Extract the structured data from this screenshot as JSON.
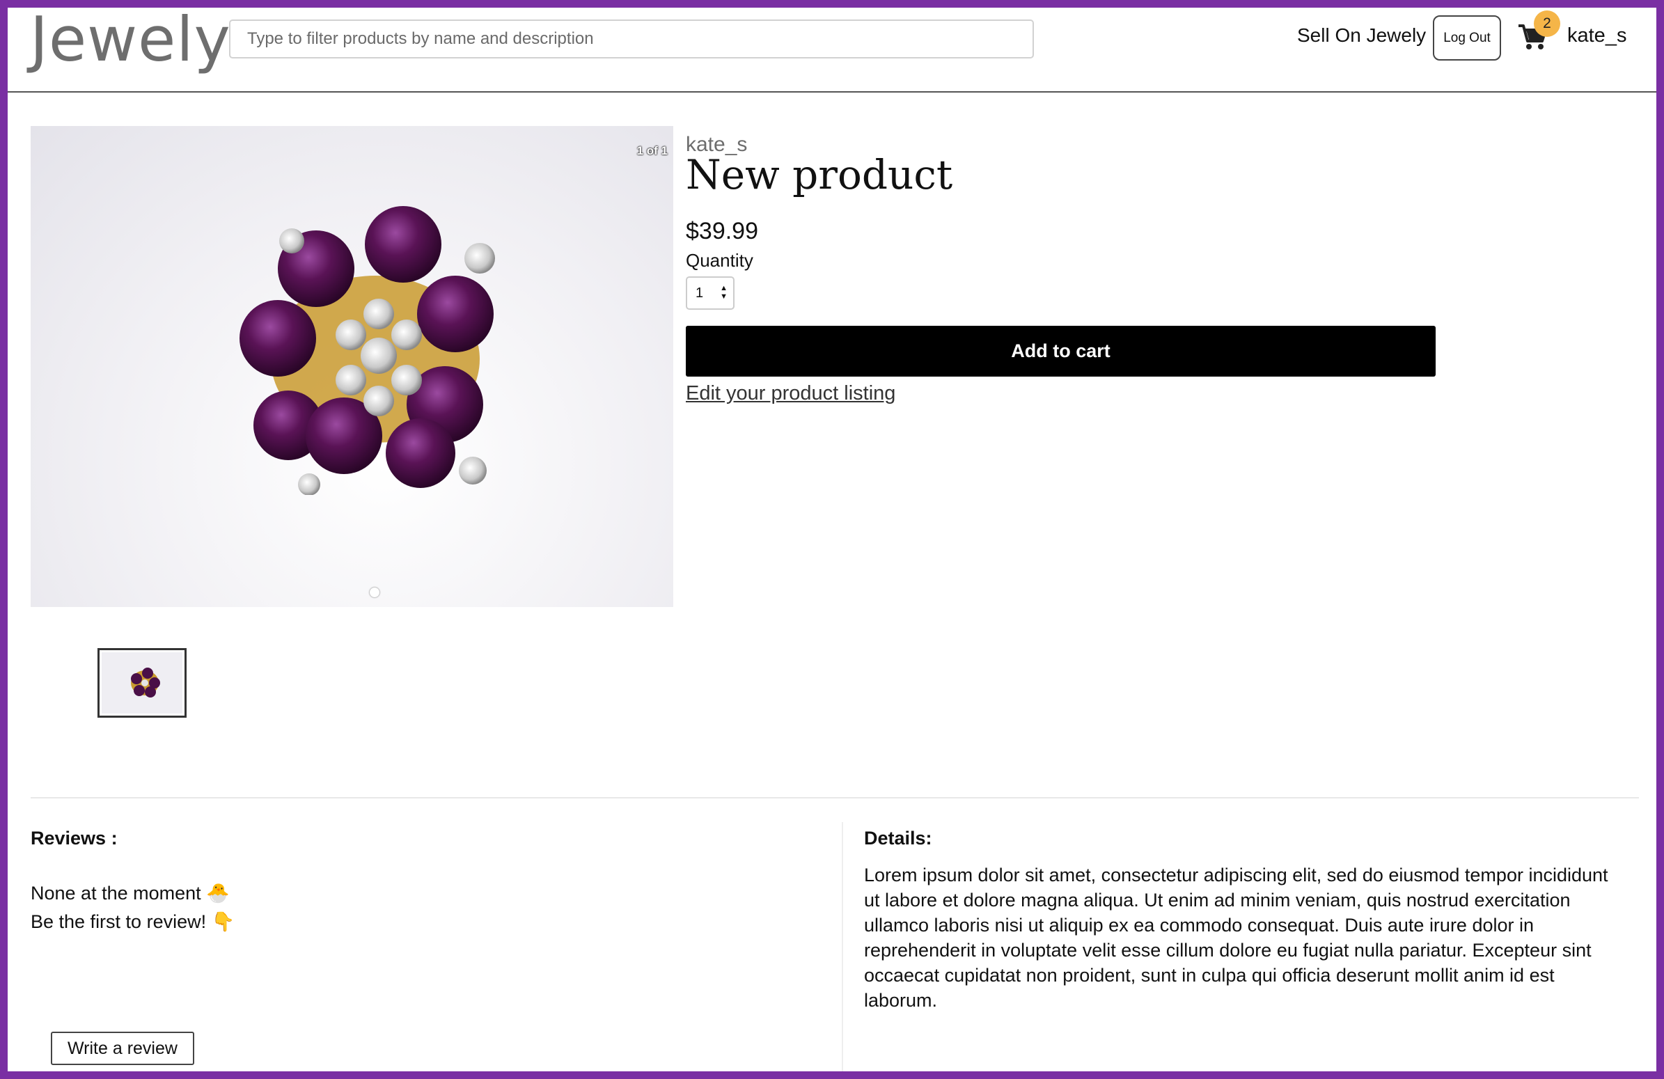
{
  "header": {
    "logo": "Jewely",
    "search_placeholder": "Type to filter products by name and description",
    "sell_label": "Sell On Jewely",
    "logout_label": "Log Out",
    "cart_count": "2",
    "username": "kate_s"
  },
  "product": {
    "image_counter": "1 of 1",
    "seller": "kate_s",
    "title": "New product",
    "price": "$39.99",
    "quantity_label": "Quantity",
    "quantity_value": "1",
    "add_to_cart_label": "Add to cart",
    "edit_link": "Edit your product listing"
  },
  "reviews": {
    "heading": "Reviews :",
    "empty_line_1": "None at the moment 🐣",
    "empty_line_2": "Be the first to review! 👇",
    "write_button": "Write a review"
  },
  "details": {
    "heading": "Details:",
    "body": "Lorem ipsum dolor sit amet, consectetur adipiscing elit, sed do eiusmod tempor incididunt ut labore et dolore magna aliqua. Ut enim ad minim veniam, quis nostrud exercitation ullamco laboris nisi ut aliquip ex ea commodo consequat. Duis aute irure dolor in reprehenderit in voluptate velit esse cillum dolore eu fugiat nulla pariatur. Excepteur sint occaecat cupidatat non proident, sunt in culpa qui officia deserunt mollit anim id est laborum."
  },
  "colors": {
    "frame": "#7a2fa3",
    "badge": "#f5b548",
    "button": "#000000"
  },
  "icons": [
    "cart-icon",
    "jewel-ring-image"
  ]
}
